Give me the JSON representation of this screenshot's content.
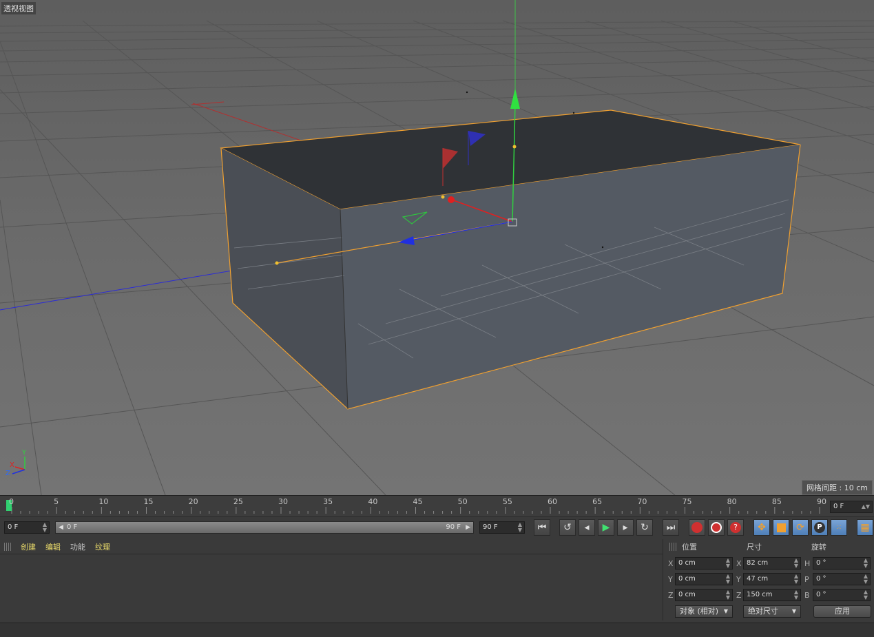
{
  "viewport": {
    "label": "透视视图",
    "grid_spacing": "网格间距 : 10 cm",
    "axis_labels": {
      "x": "X",
      "y": "Y",
      "z": "Z"
    }
  },
  "timeline": {
    "ticks": [
      "0",
      "5",
      "10",
      "15",
      "20",
      "25",
      "30",
      "35",
      "40",
      "45",
      "50",
      "55",
      "60",
      "65",
      "70",
      "75",
      "80",
      "85",
      "90"
    ],
    "current_frame": "0 F"
  },
  "transport": {
    "start_field": "0 F",
    "range_start": "0 F",
    "range_end": "90 F",
    "end_field": "90 F",
    "buttons": {
      "goto_start": "go-to-start-icon",
      "prev_key": "previous-keyframe-icon",
      "prev_frame": "previous-frame-icon",
      "play": "play-icon",
      "next_frame": "next-frame-icon",
      "next_key": "next-keyframe-icon",
      "goto_end": "go-to-end-icon",
      "record": "record-icon",
      "autokey": "auto-keyframe-icon",
      "keyframe_select": "keyframe-selection-icon",
      "move": "move-icon",
      "scale": "scale-icon",
      "rotate": "rotate-icon",
      "param": "parameter-icon",
      "pla": "pla-icon",
      "timeline": "timeline-window-icon"
    },
    "param_label": "P"
  },
  "material_manager": {
    "menu": [
      "创建",
      "编辑",
      "功能",
      "纹理"
    ]
  },
  "coordinates": {
    "headers": {
      "position": "位置",
      "size": "尺寸",
      "rotation": "旋转"
    },
    "position": [
      {
        "axis": "X",
        "value": "0 cm"
      },
      {
        "axis": "Y",
        "value": "0 cm"
      },
      {
        "axis": "Z",
        "value": "0 cm"
      }
    ],
    "size": [
      {
        "axis": "X",
        "value": "82 cm"
      },
      {
        "axis": "Y",
        "value": "47 cm"
      },
      {
        "axis": "Z",
        "value": "150 cm"
      }
    ],
    "rotation": [
      {
        "axis": "H",
        "value": "0 °"
      },
      {
        "axis": "P",
        "value": "0 °"
      },
      {
        "axis": "B",
        "value": "0 °"
      }
    ],
    "mode_dropdown": "对象 (相对)",
    "size_dropdown": "绝对尺寸",
    "apply_label": "应用"
  },
  "colors": {
    "selection_outline": "#f0a030",
    "x_axis": "#e02020",
    "y_axis": "#20d040",
    "z_axis": "#2030e0"
  }
}
